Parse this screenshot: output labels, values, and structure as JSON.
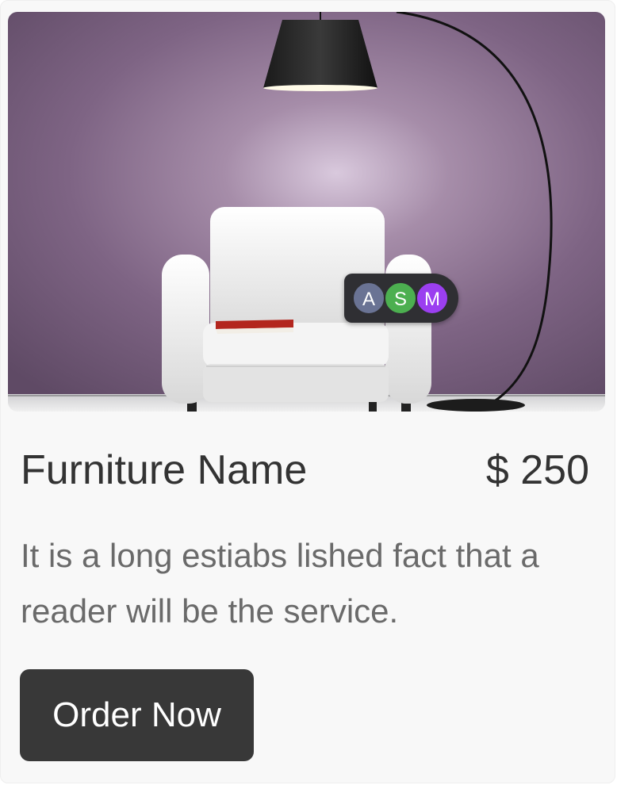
{
  "product": {
    "title": "Furniture Name",
    "price": "$ 250",
    "description": "It is a long estiabs lished fact that a reader will be the service.",
    "order_label": "Order Now"
  },
  "avatars": [
    {
      "initial": "A",
      "color": "#6a7394"
    },
    {
      "initial": "S",
      "color": "#4caf50"
    },
    {
      "initial": "M",
      "color": "#9b3ff0"
    }
  ],
  "colors": {
    "card_bg": "#f8f8f8",
    "wall": "#7b6380",
    "button_bg": "#383838",
    "text_dark": "#333333",
    "text_muted": "#6a6a6a"
  },
  "image": {
    "icon": "armchair-lamp-photo"
  }
}
